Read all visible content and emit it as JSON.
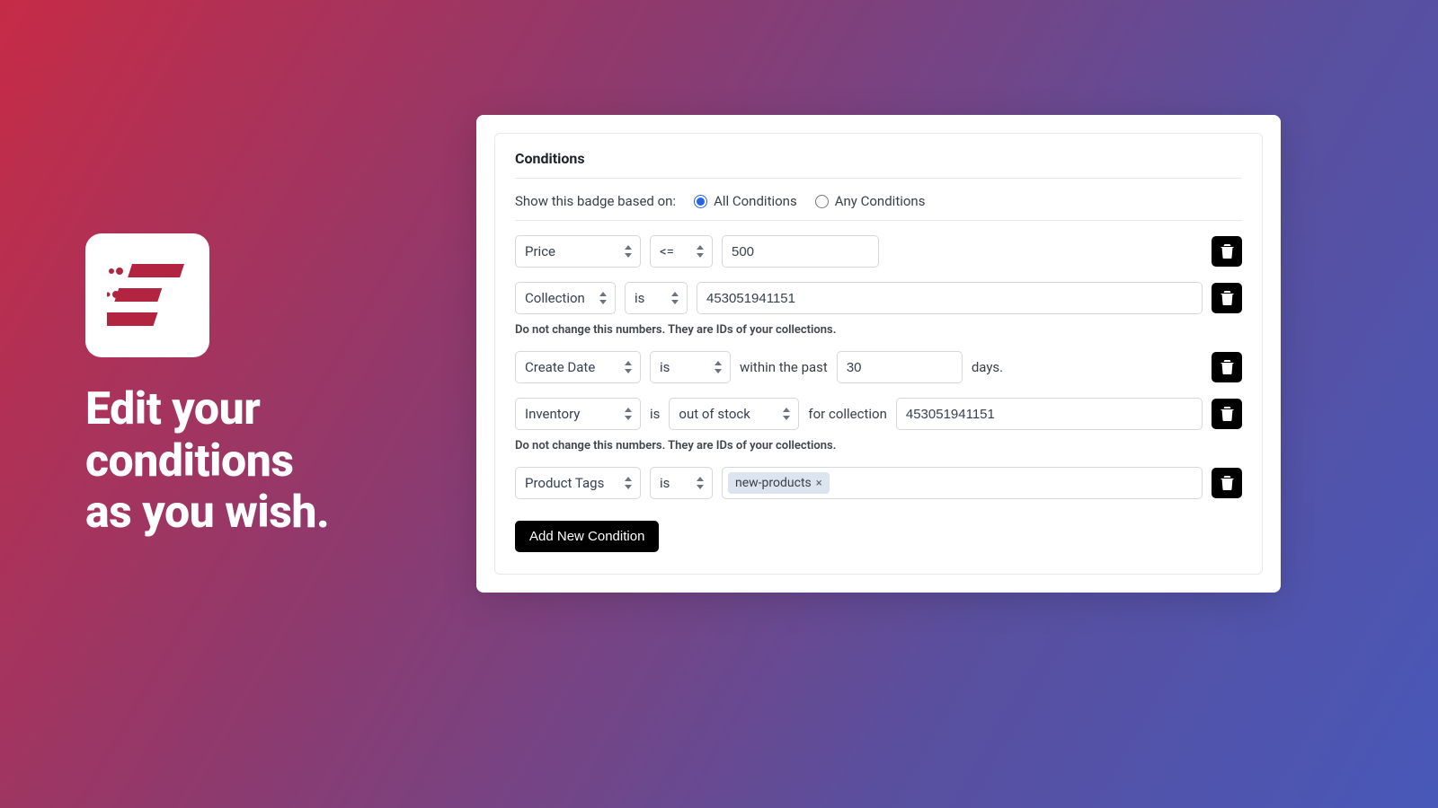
{
  "marketing": {
    "headline_line1": "Edit your",
    "headline_line2": "conditions",
    "headline_line3": "as you wish."
  },
  "panel": {
    "title": "Conditions",
    "prompt": "Show this badge based on:",
    "radio_all": "All Conditions",
    "radio_any": "Any Conditions",
    "helper_ids": "Do not change this numbers. They are IDs of your collections.",
    "add_button": "Add New Condition"
  },
  "rows": {
    "r1": {
      "field": "Price",
      "op": "<=",
      "value": "500"
    },
    "r2": {
      "field": "Collection",
      "op": "is",
      "value": "453051941151"
    },
    "r3": {
      "field": "Create Date",
      "op": "is",
      "prefix": "within the past",
      "value": "30",
      "suffix": "days."
    },
    "r4": {
      "field": "Inventory",
      "state": "out of stock",
      "for_label": "for collection",
      "is_label": "is",
      "value": "453051941151"
    },
    "r5": {
      "field": "Product Tags",
      "op": "is",
      "tag": "new-products"
    }
  }
}
